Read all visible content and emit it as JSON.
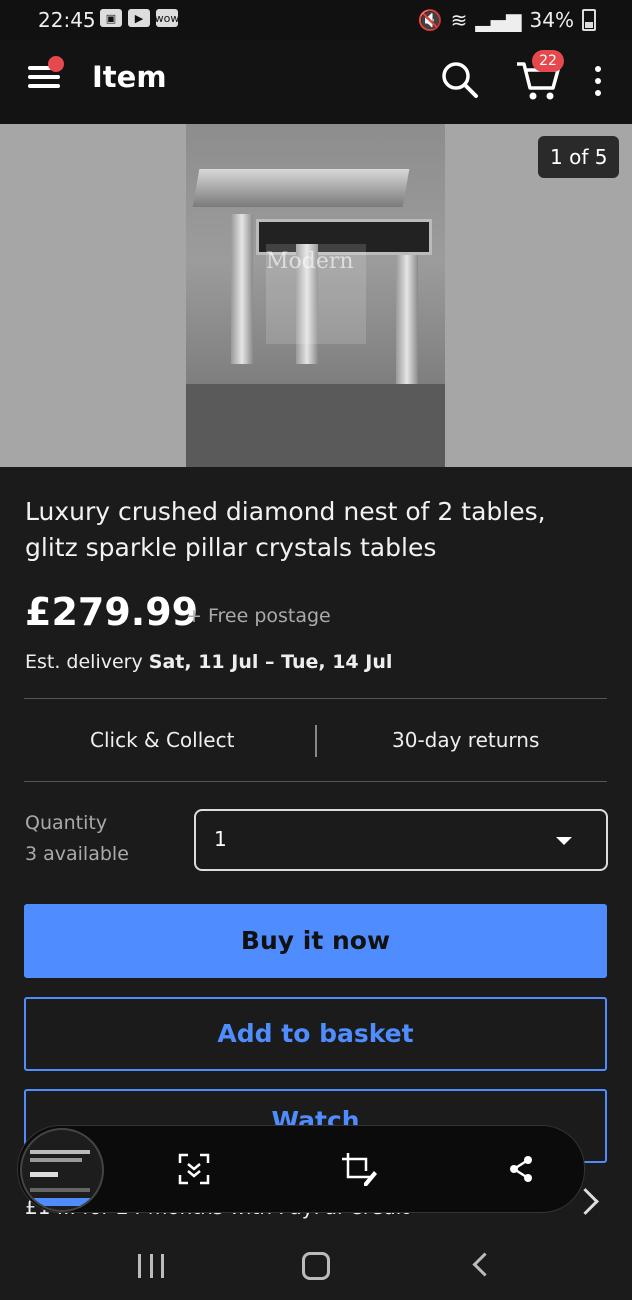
{
  "status": {
    "time": "22:45",
    "left_icons": [
      "gallery-icon",
      "youtube-icon",
      "wow-icon"
    ],
    "left_icon_labels": [
      "",
      "",
      "wow"
    ],
    "battery": "34%"
  },
  "appbar": {
    "title": "Item",
    "cart_count": "22"
  },
  "gallery": {
    "counter": "1 of 5",
    "watermark": "Modern"
  },
  "product": {
    "title": "Luxury crushed diamond nest of 2 tables, glitz sparkle pillar crystals tables",
    "price": "£279.99",
    "postage": "+ Free postage",
    "delivery_prefix": "Est. delivery ",
    "delivery_dates": "Sat, 11 Jul – Tue, 14 Jul"
  },
  "features": {
    "collect": "Click & Collect",
    "returns": "30-day returns"
  },
  "quantity": {
    "label": "Quantity",
    "available": "3 available",
    "selected": "1"
  },
  "buttons": {
    "buy": "Buy it now",
    "basket": "Add to basket",
    "watch": "Watch"
  },
  "paypal": {
    "text": "£1 ... for 24 months with PayPal Credit"
  },
  "colors": {
    "accent": "#4f8dff",
    "badge": "#e5484d",
    "background": "#1b1b1b"
  }
}
